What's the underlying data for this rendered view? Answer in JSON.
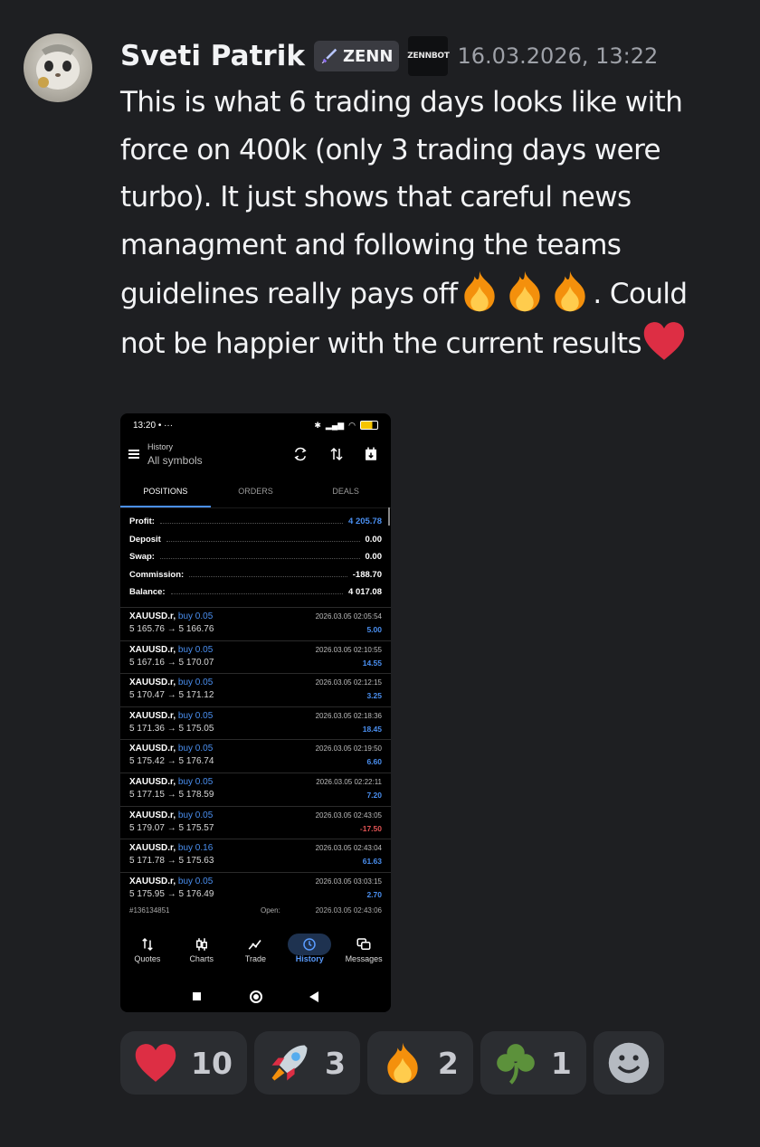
{
  "author": {
    "name": "Sveti Patrik",
    "tag": "ZENN",
    "bot_badge": "ZENNBOT",
    "timestamp": "16.03.2026, 13:22"
  },
  "message": {
    "part1": "This is what 6 trading days looks like with force on 400k (only 3 trading days were turbo). It just shows that careful news managment and following the teams guidelines really pays off",
    "part2": ". Could not be happier with the current results"
  },
  "screenshot": {
    "status_time": "13:20",
    "status_extra": "• ···",
    "header_title": "History",
    "header_subtitle": "All symbols",
    "tabs": [
      "POSITIONS",
      "ORDERS",
      "DEALS"
    ],
    "summary": [
      {
        "label": "Profit:",
        "value": "4 205.78"
      },
      {
        "label": "Deposit",
        "value": "0.00"
      },
      {
        "label": "Swap:",
        "value": "0.00"
      },
      {
        "label": "Commission:",
        "value": "-188.70"
      },
      {
        "label": "Balance:",
        "value": "4 017.08"
      }
    ],
    "positions": [
      {
        "symbol": "XAUUSD.r,",
        "side": "buy 0.05",
        "prices": "5 165.76 → 5 166.76",
        "time": "2026.03.05 02:05:54",
        "pl": "5.00"
      },
      {
        "symbol": "XAUUSD.r,",
        "side": "buy 0.05",
        "prices": "5 167.16 → 5 170.07",
        "time": "2026.03.05 02:10:55",
        "pl": "14.55"
      },
      {
        "symbol": "XAUUSD.r,",
        "side": "buy 0.05",
        "prices": "5 170.47 → 5 171.12",
        "time": "2026.03.05 02:12:15",
        "pl": "3.25"
      },
      {
        "symbol": "XAUUSD.r,",
        "side": "buy 0.05",
        "prices": "5 171.36 → 5 175.05",
        "time": "2026.03.05 02:18:36",
        "pl": "18.45"
      },
      {
        "symbol": "XAUUSD.r,",
        "side": "buy 0.05",
        "prices": "5 175.42 → 5 176.74",
        "time": "2026.03.05 02:19:50",
        "pl": "6.60"
      },
      {
        "symbol": "XAUUSD.r,",
        "side": "buy 0.05",
        "prices": "5 177.15 → 5 178.59",
        "time": "2026.03.05 02:22:11",
        "pl": "7.20"
      },
      {
        "symbol": "XAUUSD.r,",
        "side": "buy 0.05",
        "prices": "5 179.07 → 5 175.57",
        "time": "2026.03.05 02:43:05",
        "pl": "-17.50"
      },
      {
        "symbol": "XAUUSD.r,",
        "side": "buy 0.16",
        "prices": "5 171.78 → 5 175.63",
        "time": "2026.03.05 02:43:04",
        "pl": "61.63"
      },
      {
        "symbol": "XAUUSD.r,",
        "side": "buy 0.05",
        "prices": "5 175.95 → 5 176.49",
        "time": "2026.03.05 03:03:15",
        "pl": "2.70"
      }
    ],
    "ticket": {
      "id": "#136134851",
      "open_label": "Open:",
      "open_time": "2026.03.05 02:43:06"
    },
    "bottom_nav": [
      {
        "label": "Quotes",
        "icon": "quotes-icon"
      },
      {
        "label": "Charts",
        "icon": "candles-icon"
      },
      {
        "label": "Trade",
        "icon": "trend-icon"
      },
      {
        "label": "History",
        "icon": "history-icon"
      },
      {
        "label": "Messages",
        "icon": "chat-icon"
      }
    ]
  },
  "reactions": [
    {
      "emoji": "heart",
      "count": "10"
    },
    {
      "emoji": "rocket",
      "count": "3"
    },
    {
      "emoji": "fire",
      "count": "2"
    },
    {
      "emoji": "shamrock",
      "count": "1"
    }
  ],
  "colors": {
    "background": "#1e1f22",
    "reaction_bg": "#2b2d31",
    "accent_blue": "#4a8ff0",
    "loss_red": "#e05353"
  }
}
